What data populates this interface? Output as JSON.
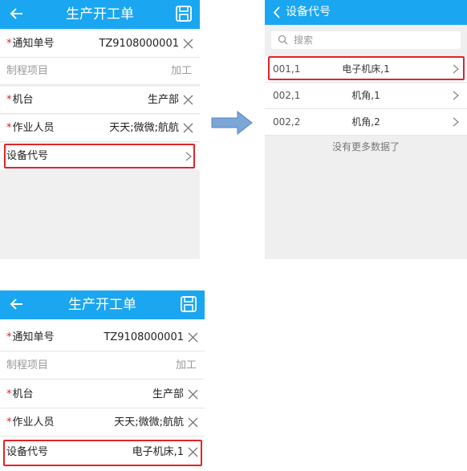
{
  "screen1": {
    "title": "生产开工单",
    "rows": [
      {
        "required": "*",
        "label": "通知单号",
        "value": "TZ9108000001"
      },
      {
        "label": "制程项目",
        "value": "加工"
      },
      {
        "required": "*",
        "label": "机台",
        "value": "生产部"
      },
      {
        "required": "*",
        "label": "作业人员",
        "value": "天天;微微;航航"
      },
      {
        "label": "设备代号",
        "value": ""
      }
    ]
  },
  "screen2": {
    "title": "设备代号",
    "search_placeholder": "搜索",
    "items": [
      {
        "code": "001,1",
        "name": "电子机床,1"
      },
      {
        "code": "002,1",
        "name": "机角,1"
      },
      {
        "code": "002,2",
        "name": "机角,2"
      }
    ],
    "empty_text": "没有更多数据了"
  },
  "screen3": {
    "title": "生产开工单",
    "rows": [
      {
        "required": "*",
        "label": "通知单号",
        "value": "TZ9108000001"
      },
      {
        "label": "制程项目",
        "value": "加工"
      },
      {
        "required": "*",
        "label": "机台",
        "value": "生产部"
      },
      {
        "required": "*",
        "label": "作业人员",
        "value": "天天;微微;航航"
      },
      {
        "label": "设备代号",
        "value": "电子机床,1"
      }
    ]
  },
  "colors": {
    "accent": "#1aa6f0",
    "highlight": "#e0242a",
    "arrow": "#7aa6d8"
  },
  "icons": [
    "back-arrow-icon",
    "save-icon",
    "clear-icon",
    "chevron-right-icon",
    "search-icon",
    "flow-arrow-icon"
  ]
}
